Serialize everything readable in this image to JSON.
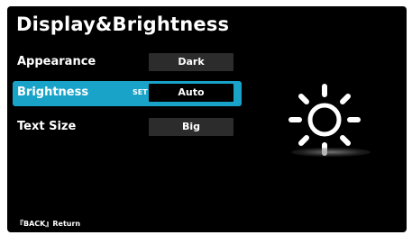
{
  "title": "Display&Brightness",
  "menu": [
    {
      "label": "Appearance",
      "value": "Dark",
      "selected": false
    },
    {
      "label": "Brightness",
      "value": "Auto",
      "selected": true,
      "tag": "SET"
    },
    {
      "label": "Text Size",
      "value": "Big",
      "selected": false
    }
  ],
  "illustration": {
    "icon": "sun-icon"
  },
  "footer": {
    "text": "『BACK』Return"
  },
  "colors": {
    "background": "#000000",
    "highlight": "#1aa3c9",
    "value_box": "#2c2c2c",
    "text": "#ffffff"
  }
}
